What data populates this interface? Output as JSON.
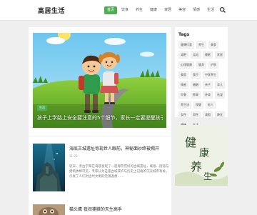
{
  "site": {
    "logo_text": "高居生活"
  },
  "nav": {
    "items": [
      {
        "label": "首页",
        "active": true
      },
      {
        "label": "饮食"
      },
      {
        "label": "养生"
      },
      {
        "label": "健康"
      },
      {
        "label": "家居"
      },
      {
        "label": "美容"
      },
      {
        "label": "情感"
      },
      {
        "label": "生活"
      }
    ],
    "search_icon": "search-icon"
  },
  "featured": {
    "tag": "生活",
    "caption": "孩子上学路上安全要注意的5个细节，家长一定要提醒孩子"
  },
  "articles": [
    {
      "title": "海底古城遗址惊现世人眼前，神秘面纱终被揭开",
      "date": "11-23",
      "excerpt": "近日，考古学家在海底发现了一座保存完好的古城遗址，城墙、街道与建筑依稀可见，专家认为这座古城或许与历史上记载的沉没城市有关，引发了人们对古代文明的无限遐想……"
    },
    {
      "title": "猫头鹰 夜间捕猎的天生高手"
    }
  ],
  "sidebar": {
    "tags_title": "Tags",
    "tags": [
      "健康饮食",
      "养生",
      "美食",
      "减肥",
      "运动",
      "睡眠",
      "家居",
      "心理健康",
      "健身",
      "护肤",
      "美容",
      "食疗",
      "中医养生",
      "情感",
      "婚姻",
      "亲子",
      "育儿",
      "早餐",
      "养胃",
      "补肾",
      "祛湿",
      "养生汤",
      "保健",
      "老人",
      "女性",
      "男性",
      "减脂",
      "降压",
      "降糖",
      "生活"
    ],
    "ad_text": "健康养生"
  },
  "colors": {
    "accent": "#4caf50"
  }
}
